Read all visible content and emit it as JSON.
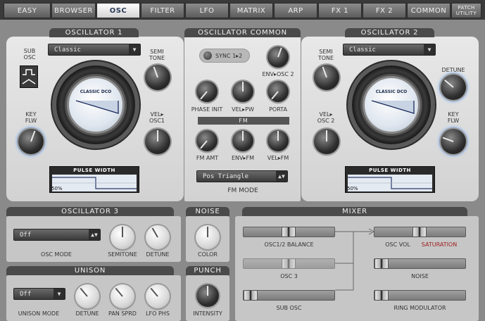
{
  "tabs": [
    {
      "label": "EASY"
    },
    {
      "label": "BROWSER"
    },
    {
      "label": "OSC",
      "active": true
    },
    {
      "label": "FILTER"
    },
    {
      "label": "LFO"
    },
    {
      "label": "MATRIX"
    },
    {
      "label": "ARP"
    },
    {
      "label": "FX 1"
    },
    {
      "label": "FX 2"
    },
    {
      "label": "COMMON"
    },
    {
      "label_line1": "PATCH",
      "label_line2": "UTILITY"
    }
  ],
  "osc1": {
    "title": "OSCILLATOR 1",
    "waveform": "Classic",
    "sub_osc": "SUB\nOSC",
    "semitone": "SEMI\nTONE",
    "keyflw": "KEY\nFLW",
    "vel_osc": "VEL▸\nOSC1",
    "dial_label": "CLASSIC DCO",
    "pulse_title": "PULSE WIDTH",
    "pulse_value": "50%"
  },
  "osc_common": {
    "title": "OSCILLATOR COMMON",
    "sync": "SYNC 1▸2",
    "env_osc2": "ENV▸OSC 2",
    "phase_init": "PHASE INIT",
    "vel_pw": "VEL▸PW",
    "porta": "PORTA",
    "fm_header": "FM",
    "fm_amt": "FM AMT",
    "env_fm": "ENV▸FM",
    "vel_fm": "VEL▸FM",
    "fm_mode_value": "Pos Triangle",
    "fm_mode_label": "FM MODE"
  },
  "osc2": {
    "title": "OSCILLATOR 2",
    "waveform": "Classic",
    "semitone": "SEMI\nTONE",
    "detune": "DETUNE",
    "vel_osc": "VEL▸\nOSC 2",
    "keyflw": "KEY\nFLW",
    "dial_label": "CLASSIC DCO",
    "pulse_title": "PULSE WIDTH",
    "pulse_value": "50%"
  },
  "osc3": {
    "title": "OSCILLATOR 3",
    "mode_value": "Off",
    "mode_label": "OSC MODE",
    "semitone": "SEMITONE",
    "detune": "DETUNE"
  },
  "noise": {
    "title": "NOISE",
    "color": "COLOR"
  },
  "unison": {
    "title": "UNISON",
    "mode_value": "Off",
    "mode_label": "UNISON MODE",
    "detune": "DETUNE",
    "pan_sprd": "PAN SPRD",
    "lfo_phs": "LFO PHS"
  },
  "punch": {
    "title": "PUNCH",
    "intensity": "INTENSITY"
  },
  "mixer": {
    "title": "MIXER",
    "balance": "OSC1/2 BALANCE",
    "osc3": "OSC 3",
    "sub_osc": "SUB OSC",
    "osc_vol": "OSC VOL",
    "saturation": "SATURATION",
    "noise": "NOISE",
    "ring_mod": "RING MODULATOR",
    "levels": {
      "balance": 0.5,
      "osc3": 0.5,
      "sub_osc": 0.0,
      "osc_vol": 0.5,
      "noise": 0.0,
      "ring_mod": 0.0
    }
  },
  "colors": {
    "accent": "#6fa8ff",
    "saturation": "#a02020"
  }
}
